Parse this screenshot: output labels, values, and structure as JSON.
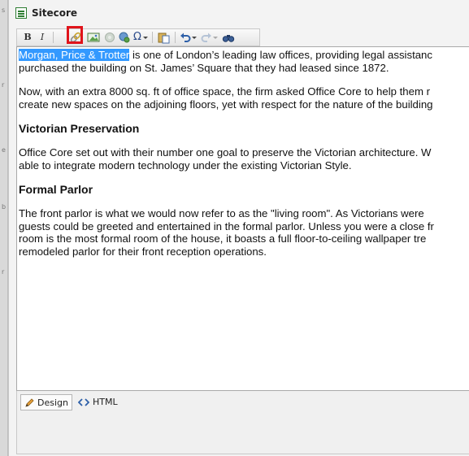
{
  "window": {
    "title": "Sitecore"
  },
  "toolbar": {
    "bold_label": "B",
    "italic_label": "I",
    "special_char_label": "Ω"
  },
  "editor": {
    "p1_selected": "Morgan, Price & Trotter",
    "p1_line1": " is one of London’s leading law offices, providing legal assistanc",
    "p1_line2": "purchased the building on St. James’ Square that they had leased since 1872.",
    "p2_line1": "Now, with an extra 8000 sq. ft of office space, the firm asked Office Core to help them r",
    "p2_line2": "create new spaces on the adjoining floors, yet with respect for the nature of the building",
    "h1": "Victorian Preservation",
    "p3_line1": "Office Core set out with their number one goal to preserve the Victorian architecture. W",
    "p3_line2": "able to integrate modern technology under the existing Victorian Style.",
    "h2": "Formal Parlor",
    "p4_line1": "The front parlor is what we would now refer to as the \"living room\". As Victorians were",
    "p4_line2": "guests could be greeted and entertained in the formal parlor. Unless you were a close fr",
    "p4_line3": "room is the most formal room of the house, it boasts a full floor-to-ceiling wallpaper tre",
    "p4_line4": "remodeled parlor for their front reception operations."
  },
  "modes": {
    "design_label": "Design",
    "html_label": "HTML"
  }
}
